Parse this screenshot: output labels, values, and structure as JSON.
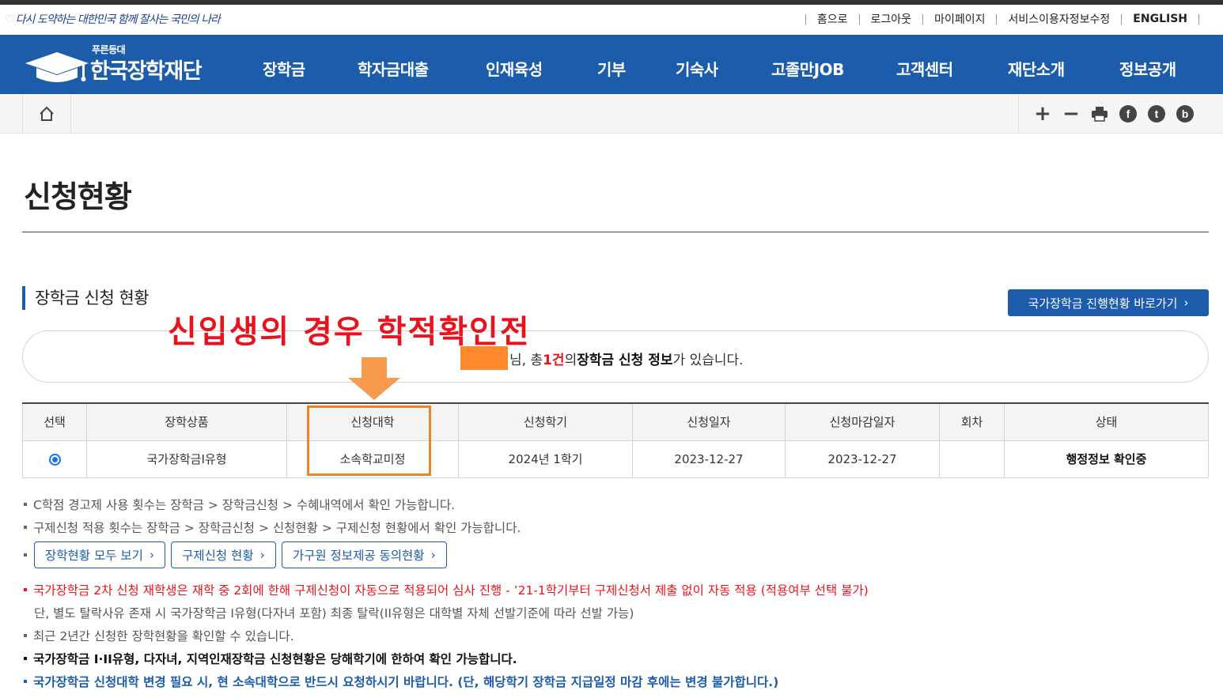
{
  "header": {
    "slogan": "다시 도약하는 대한민국 함께 잘사는 국민의 나라",
    "util_links": [
      "홈으로",
      "로그아웃",
      "마이페이지",
      "서비스이용자정보수정",
      "ENGLISH"
    ]
  },
  "logo": {
    "small": "푸른등대",
    "big": "한국장학재단"
  },
  "gnb": [
    "장학금",
    "학자금대출",
    "인재육성",
    "기부",
    "기숙사",
    "고졸만JOB",
    "고객센터",
    "재단소개",
    "정보공개"
  ],
  "page": {
    "title": "신청현황",
    "section_title": "장학금 신청 현황",
    "go_button": "국가장학금 진행현황 바로가기"
  },
  "annotation": "신입생의 경우 학적확인전",
  "info": {
    "suffix": "님, 총 ",
    "count": "1건",
    "mid": "의 ",
    "bold": "장학금 신청 정보",
    "tail": "가 있습니다."
  },
  "table": {
    "headers": [
      "선택",
      "장학상품",
      "신청대학",
      "신청학기",
      "신청일자",
      "신청마감일자",
      "회차",
      "상태"
    ],
    "rows": [
      [
        "",
        "국가장학금I유형",
        "소속학교미정",
        "2024년 1학기",
        "2023-12-27",
        "2023-12-27",
        "",
        "행정정보 확인중"
      ]
    ]
  },
  "notes": {
    "n1": "C학점 경고제 사용 횟수는 장학금 > 장학금신청 > 수혜내역에서 확인 가능합니다.",
    "n2": "구제신청 적용 횟수는 장학금 > 장학금신청 > 신청현황 > 구제신청 현황에서 확인 가능합니다.",
    "buttons": [
      "장학현황 모두 보기",
      "구제신청 현황",
      "가구원 정보제공 동의현황"
    ],
    "n3": "국가장학금 2차 신청 재학생은 재학 중 2회에 한해 구제신청이 자동으로 적용되어 심사 진행 - ’21-1학기부터 구제신청서 제출 없이 자동 적용 (적용여부 선택 불가)",
    "n3b": "단, 별도 탈락사유 존재 시 국가장학금 I유형(다자녀 포함) 최종 탈락(II유형은 대학별 자체 선발기준에 따라 선발 가능)",
    "n4": "최근 2년간 신청한 장학현황을 확인할 수 있습니다.",
    "n5": "국가장학금 I·II유형, 다자녀, 지역인재장학금 신청현황은 당해학기에 한하여 확인 가능합니다.",
    "n6": "국가장학금 신청대학 변경 필요 시, 현 소속대학으로 반드시 요청하시기 바랍니다. (단, 해당학기 장학금 지급일정 마감 후에는 변경 불가합니다.)"
  },
  "colors": {
    "brand_blue": "#1c5cab",
    "annotation_red": "#e8131c",
    "highlight_orange": "#f08423"
  }
}
